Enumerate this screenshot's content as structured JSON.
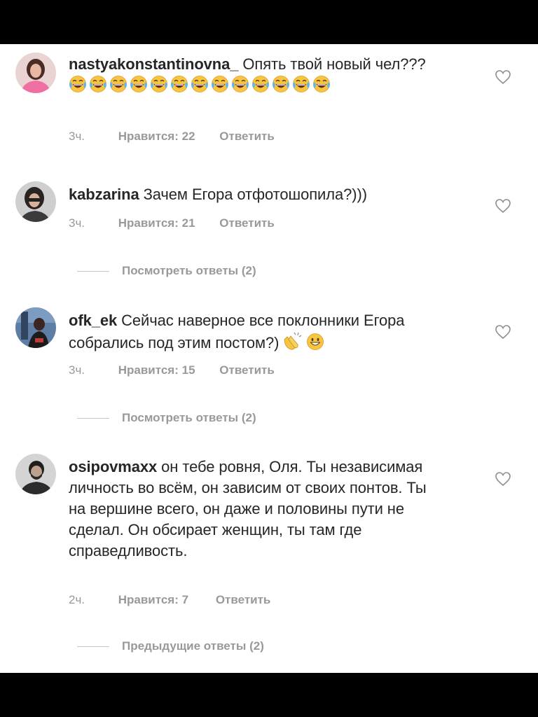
{
  "comments": [
    {
      "username": "nastyakonstantinovna_",
      "text": "Опять твой новый чел???",
      "emoji_after": "😂😂😂😂😂😂😂😂😂😂😂😂😂",
      "time": "3ч.",
      "likes": "Нравится: 22",
      "reply": "Ответить"
    },
    {
      "username": "kabzarina",
      "text": "Зачем Егора отфотошопила?)))",
      "time": "3ч.",
      "likes": "Нравится: 21",
      "reply": "Ответить",
      "view_replies": "Посмотреть ответы (2)"
    },
    {
      "username": "ofk_ek",
      "text": "Сейчас наверное все поклонники Егора собрались под этим постом?)",
      "emoji_after": "👏😀",
      "time": "3ч.",
      "likes": "Нравится: 15",
      "reply": "Ответить",
      "view_replies": "Посмотреть ответы (2)"
    },
    {
      "username": "osipovmaxx",
      "text": "он тебе ровня, Оля.  Ты независимая личность во всём, он зависим от своих понтов. Ты на вершине всего, он даже и половины пути не сделал. Он обсирает женщин, ты там где справедливость.",
      "time": "2ч.",
      "likes": "Нравится: 7",
      "reply": "Ответить",
      "view_replies": "Предыдущие ответы (2)"
    }
  ],
  "icons": {
    "like": "heart-outline-icon",
    "laugh": "tears-of-joy-emoji",
    "clap": "clapping-hands-emoji",
    "grin": "grinning-face-emoji"
  },
  "colors": {
    "text": "#262626",
    "meta": "#999999",
    "background": "#ffffff",
    "bars": "#000000"
  }
}
